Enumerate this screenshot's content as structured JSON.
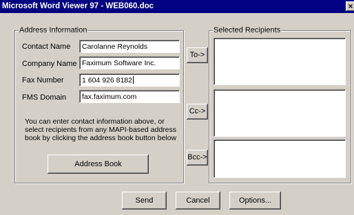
{
  "window": {
    "title": "Microsoft Word Viewer 97 - WEB060.doc",
    "close_glyph": "×"
  },
  "address": {
    "group_label": "Address Information",
    "contact_label": "Contact Name",
    "contact_value": "Carolanne Reynolds",
    "company_label": "Company Name",
    "company_value": "Faximum Software Inc.",
    "fax_label": "Fax Number",
    "fax_value": "1 604 926 8182",
    "fms_label": "FMS Domain",
    "fms_value": "fax.faximum.com",
    "info_text": "You can enter contact information above, or select recipients from any MAPI-based address book by clicking the address book button below",
    "address_book_button": "Address Book"
  },
  "recipients": {
    "group_label": "Selected Recipients",
    "to_button": "To->",
    "cc_button": "Cc->",
    "bcc_button": "Bcc->"
  },
  "footer": {
    "send": "Send",
    "cancel": "Cancel",
    "options": "Options..."
  }
}
